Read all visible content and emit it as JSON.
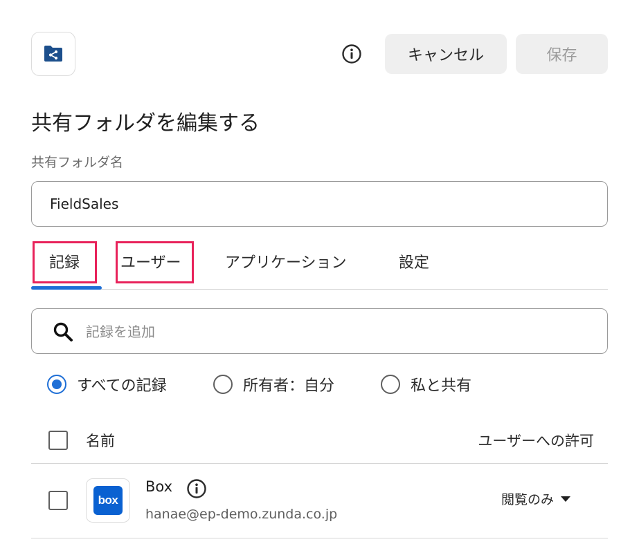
{
  "header": {
    "icon": "shared-folder-icon",
    "info_icon": "info-icon",
    "cancel_label": "キャンセル",
    "save_label": "保存"
  },
  "page_title": "共有フォルダを編集する",
  "folder_name": {
    "label": "共有フォルダ名",
    "value": "FieldSales"
  },
  "tabs": [
    {
      "label": "記録",
      "active": true
    },
    {
      "label": "ユーザー",
      "active": false
    },
    {
      "label": "アプリケーション",
      "active": false
    },
    {
      "label": "設定",
      "active": false
    }
  ],
  "highlight_color": "#e8225a",
  "accent_color": "#1f6fd6",
  "search": {
    "icon": "search-icon",
    "placeholder": "記録を追加"
  },
  "filters": [
    {
      "label": "すべての記録",
      "checked": true
    },
    {
      "label": "所有者：自分",
      "checked": false
    },
    {
      "label": "私と共有",
      "checked": false
    }
  ],
  "table": {
    "col_name": "名前",
    "col_permission": "ユーザーへの許可",
    "rows": [
      {
        "logo_text": "box",
        "title": "Box",
        "email": "hanae@ep-demo.zunda.co.jp",
        "permission": "閲覧のみ"
      }
    ]
  }
}
